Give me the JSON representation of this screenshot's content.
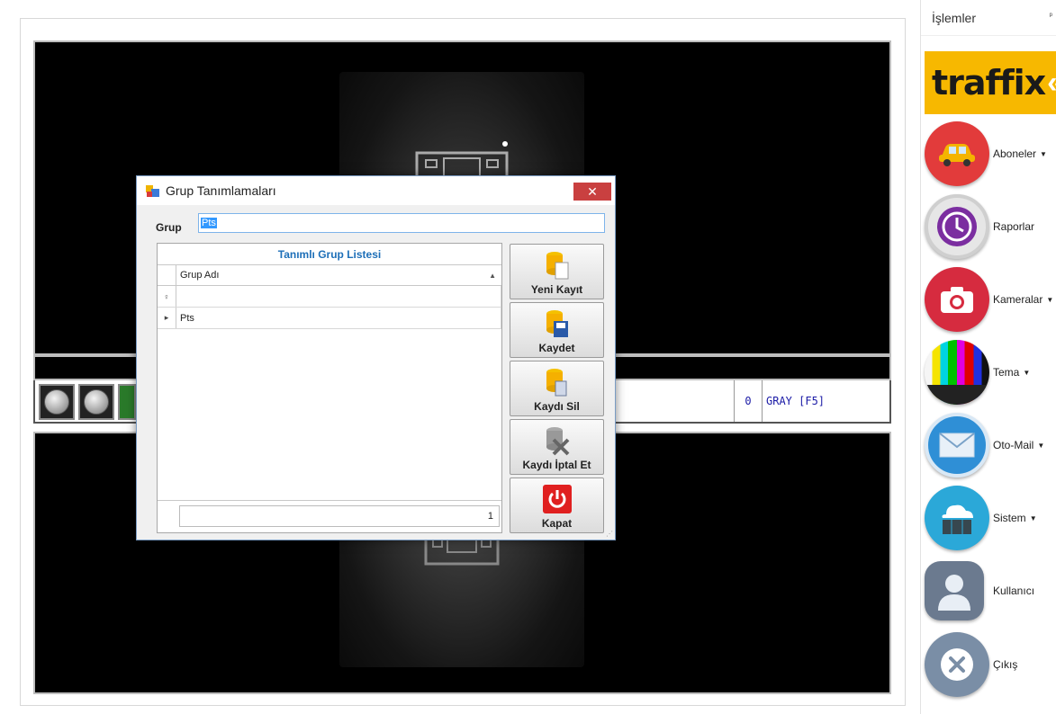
{
  "sidebar": {
    "title": "İşlemler",
    "pin_glyph": "ᵖ",
    "logo_text": "traffix",
    "items": [
      {
        "label": "Aboneler",
        "has_dropdown": true,
        "icon": "car-icon",
        "color": "#e23b3b"
      },
      {
        "label": "Raporlar",
        "has_dropdown": false,
        "icon": "clock-icon",
        "color": "#7b2ea0"
      },
      {
        "label": "Kameralar",
        "has_dropdown": true,
        "icon": "camera-icon",
        "color": "#d62b3f"
      },
      {
        "label": "Tema",
        "has_dropdown": true,
        "icon": "color-bars-icon",
        "color": "#333333"
      },
      {
        "label": "Oto-Mail",
        "has_dropdown": true,
        "icon": "mail-icon",
        "color": "#2f8fd6"
      },
      {
        "label": "Sistem",
        "has_dropdown": true,
        "icon": "cloud-server-icon",
        "color": "#2ba8d8"
      },
      {
        "label": "Kullanıcı",
        "has_dropdown": false,
        "icon": "user-icon",
        "color": "#6b7a8f"
      },
      {
        "label": "Çıkış",
        "has_dropdown": false,
        "icon": "close-circle-icon",
        "color": "#7a8ea6"
      }
    ]
  },
  "camera_bar": {
    "counter": "0",
    "mode": "GRAY [F5]"
  },
  "dialog": {
    "title": "Grup Tanımlamaları",
    "close_label": "✕",
    "field_label": "Grup",
    "field_value": "Pts",
    "grid": {
      "caption": "Tanımlı Grup Listesi",
      "column": "Grup Adı",
      "filter_glyph": "♀",
      "rows": [
        {
          "marker": "▸",
          "value": "Pts"
        }
      ],
      "count": "1"
    },
    "buttons": [
      {
        "label": "Yeni Kayıt",
        "icon": "new-record-icon"
      },
      {
        "label": "Kaydet",
        "icon": "save-database-icon"
      },
      {
        "label": "Kaydı Sil",
        "icon": "delete-record-icon"
      },
      {
        "label": "Kaydı İptal Et",
        "icon": "cancel-record-icon"
      },
      {
        "label": "Kapat",
        "icon": "power-icon"
      }
    ]
  }
}
